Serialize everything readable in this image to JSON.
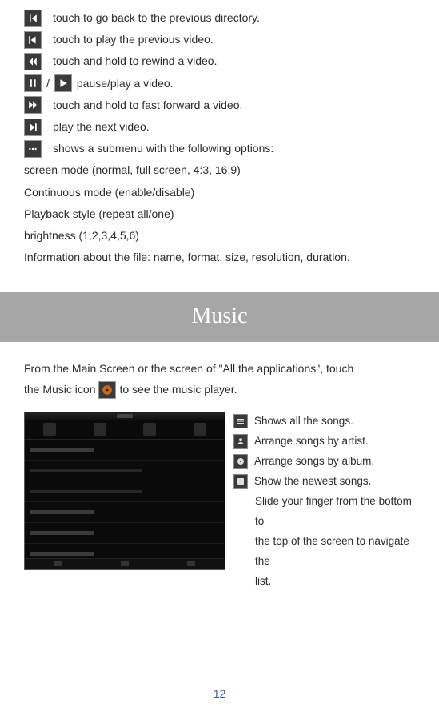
{
  "video_controls": {
    "back": "touch to go back to the previous directory.",
    "prev": "touch to play the previous video.",
    "rewind": "touch and hold to rewind a video.",
    "pause_play_sep": " / ",
    "pause_play_text": " pause/play a video.",
    "ffwd": "touch and hold to fast forward a video.",
    "next": "play the next video.",
    "menu": "shows a submenu with the following options:"
  },
  "submenu_lines": [
    "screen mode (normal, full screen, 4:3, 16:9)",
    "Continuous mode (enable/disable)",
    "Playback style (repeat all/one)",
    "brightness (1,2,3,4,5,6)",
    "Information about the file: name, format, size, resolution, duration."
  ],
  "section_title": "Music",
  "music_intro_line1": "From the Main Screen or the screen of \"All the applications\", touch",
  "music_intro_before_icon": "the Music icon ",
  "music_intro_after_icon": "to see the music player.",
  "music_options": {
    "all_songs": "Shows all the songs.",
    "by_artist": "Arrange songs by artist.",
    "by_album": "Arrange songs by album.",
    "newest": "Show the newest songs.",
    "slide1": "Slide your finger from the bottom to",
    "slide2": "the top of the screen to navigate the",
    "slide3": "list."
  },
  "page_number": "12"
}
